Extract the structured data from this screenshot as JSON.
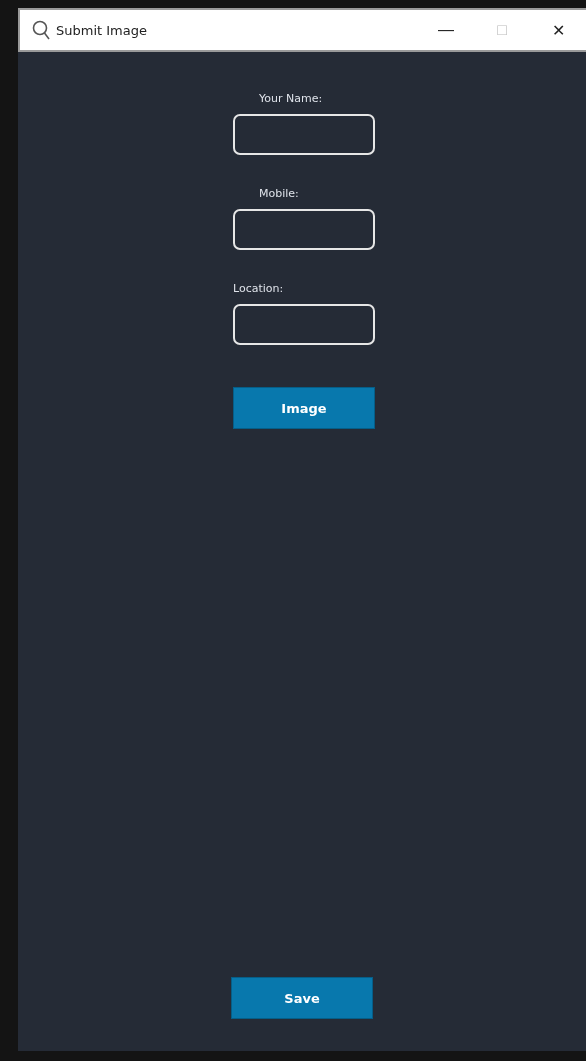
{
  "window": {
    "title": "Submit Image",
    "controls": [
      "—",
      "□",
      "✕"
    ]
  },
  "fields": [
    {
      "label": "Your Name:"
    },
    {
      "label": "Mobile:"
    },
    {
      "label": "Location:"
    }
  ],
  "buttons": [
    "Image",
    "Save"
  ]
}
